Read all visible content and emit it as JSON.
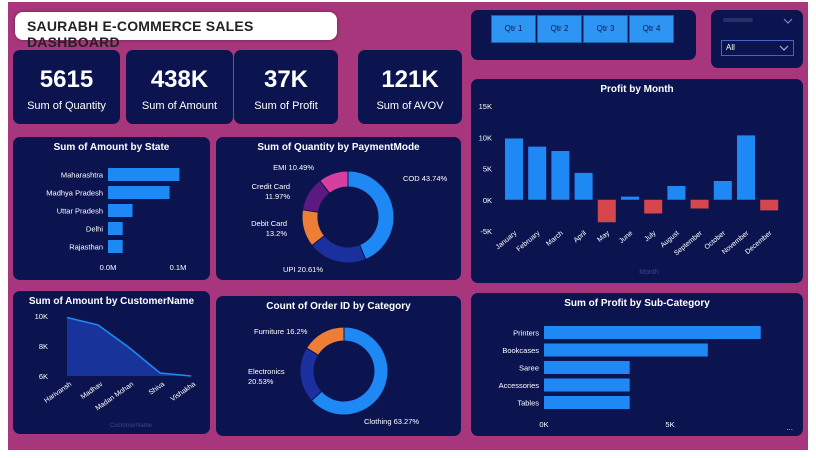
{
  "dashboard_title": "SAURABH E-COMMERCE SALES DASHBOARD",
  "kpis": [
    {
      "value": "5615",
      "label": "Sum of Quantity"
    },
    {
      "value": "438K",
      "label": "Sum of Amount"
    },
    {
      "value": "37K",
      "label": "Sum of Profit"
    },
    {
      "value": "121K",
      "label": "Sum of AVOV"
    }
  ],
  "slicer_quarters": [
    "Qtr 1",
    "Qtr 2",
    "Qtr 3",
    "Qtr 4"
  ],
  "slicer_state": {
    "selected": "All"
  },
  "colors": {
    "bar": "#1e88f5",
    "negative": "#d6474d",
    "card": "#0c1450",
    "background": "#a8367c"
  },
  "chart_data": [
    {
      "id": "amount_by_state",
      "type": "bar",
      "orientation": "horizontal",
      "title": "Sum of Amount by State",
      "categories": [
        "Maharashtra",
        "Madhya Pradesh",
        "Uttar Pradesh",
        "Delhi",
        "Rajasthan"
      ],
      "values": [
        0.102,
        0.088,
        0.035,
        0.021,
        0.021
      ],
      "xticks": [
        "0.0M",
        "0.1M"
      ],
      "xlim": [
        0,
        0.15
      ]
    },
    {
      "id": "quantity_by_paymentmode",
      "type": "pie",
      "donut": true,
      "title": "Sum of Quantity by PaymentMode",
      "labels": [
        "COD",
        "UPI",
        "Debit Card",
        "Credit Card",
        "EMI"
      ],
      "values": [
        43.74,
        20.61,
        13.2,
        11.97,
        10.49
      ],
      "display": [
        "COD 43.74%",
        "UPI 20.61%",
        "Debit Card 13.2%",
        "Credit Card 11.97%",
        "EMI 10.49%"
      ],
      "colors": [
        "#1e88f5",
        "#1b2f9e",
        "#ee7d35",
        "#5c1a80",
        "#d63fa0"
      ]
    },
    {
      "id": "profit_by_month",
      "type": "bar",
      "title": "Profit by Month",
      "categories": [
        "January",
        "February",
        "March",
        "April",
        "May",
        "June",
        "July",
        "August",
        "September",
        "October",
        "November",
        "December"
      ],
      "values": [
        9800,
        8500,
        7800,
        4300,
        -3600,
        500,
        -2200,
        2200,
        -1400,
        3000,
        10300,
        -1700
      ],
      "yticks": [
        "15K",
        "10K",
        "5K",
        "0K",
        "-5K"
      ],
      "ylim": [
        -5000,
        15000
      ],
      "xlabel": "Month"
    },
    {
      "id": "amount_by_customer",
      "type": "area",
      "title": "Sum of Amount by CustomerName",
      "categories": [
        "Harivansh",
        "Madhav",
        "Madan Mohan",
        "Shiva",
        "Vishakha"
      ],
      "values": [
        9900,
        9400,
        7900,
        6200,
        6000
      ],
      "yticks": [
        "10K",
        "8K",
        "6K"
      ],
      "ylim": [
        6000,
        10000
      ],
      "xlabel": "CustomerName"
    },
    {
      "id": "orders_by_category",
      "type": "pie",
      "donut": true,
      "title": "Count of Order ID by Category",
      "labels": [
        "Clothing",
        "Electronics",
        "Furniture"
      ],
      "values": [
        63.27,
        20.53,
        16.2
      ],
      "display": [
        "Clothing 63.27%",
        "Electronics 20.53%",
        "Furniture 16.2%"
      ],
      "colors": [
        "#1e88f5",
        "#1b2f9e",
        "#ee7d35"
      ]
    },
    {
      "id": "profit_by_subcategory",
      "type": "bar",
      "orientation": "horizontal",
      "title": "Sum of Profit by Sub-Category",
      "categories": [
        "Printers",
        "Bookcases",
        "Saree",
        "Accessories",
        "Tables"
      ],
      "values": [
        8600,
        6500,
        3400,
        3400,
        3400
      ],
      "xticks": [
        "0K",
        "5K"
      ],
      "xlim": [
        0,
        10000
      ]
    }
  ]
}
